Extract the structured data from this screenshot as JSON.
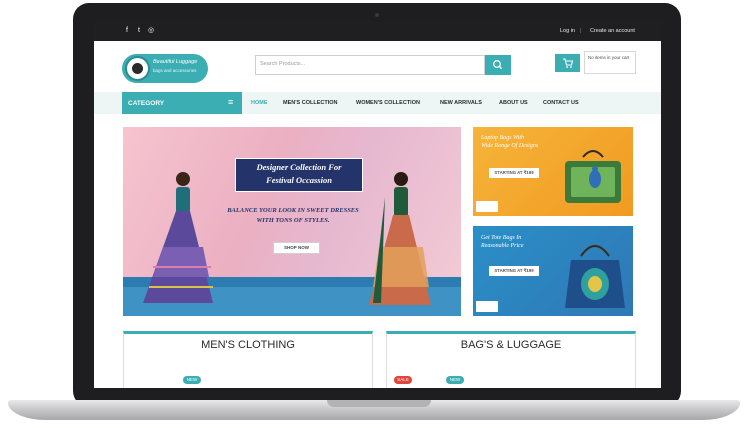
{
  "topbar": {
    "social": [
      {
        "icon": "facebook-icon",
        "glyph": "f"
      },
      {
        "icon": "twitter-icon",
        "glyph": "t"
      },
      {
        "icon": "instagram-icon",
        "glyph": "◎"
      }
    ],
    "login": "Log in",
    "separator": "|",
    "create_account": "Create an account"
  },
  "header": {
    "logo_name": "Beautiful Luggage",
    "logo_tagline": "bags and accessories",
    "search_placeholder": "Search Products...",
    "search_icon": "search-icon",
    "cart_icon": "cart-icon",
    "cart_text": "No items in your cart"
  },
  "nav": {
    "category_label": "CATEGORY",
    "menu_icon": "hamburger-icon",
    "items": [
      {
        "label": "HOME",
        "active": true
      },
      {
        "label": "MEN'S COLLECTION",
        "active": false
      },
      {
        "label": "WOMEN'S COLLECTION",
        "active": false
      },
      {
        "label": "NEW ARRIVALS",
        "active": false
      },
      {
        "label": "ABOUT US",
        "active": false
      },
      {
        "label": "CONTACT US",
        "active": false
      }
    ]
  },
  "hero": {
    "title_line1": "Designer Collection For",
    "title_line2": "Festival Occassion",
    "subtitle_line1": "BALANCE YOUR LOOK IN SWEET DRESSES",
    "subtitle_line2": "WITH TONS OF STYLES.",
    "button": "SHOP NOW"
  },
  "side_banners": [
    {
      "title_line1": "Laptop Bags With",
      "title_line2": "Wide Range Of Designs",
      "button": "STARTING AT ₹199"
    },
    {
      "title_line1": "Get Tote Bags In",
      "title_line2": "Reasonable Price",
      "button": "STARTING AT ₹199"
    }
  ],
  "panels": [
    {
      "title": "MEN'S CLOTHING",
      "badges": [
        "NEW"
      ]
    },
    {
      "title": "BAG'S & LUGGAGE",
      "badges": [
        "SALE",
        "NEW"
      ]
    }
  ],
  "colors": {
    "accent": "#3aaeb3",
    "dark": "#1f1f22",
    "hero_pink": "#f3c0cc",
    "banner_orange": "#f3a22a",
    "banner_blue": "#2b86c1"
  }
}
